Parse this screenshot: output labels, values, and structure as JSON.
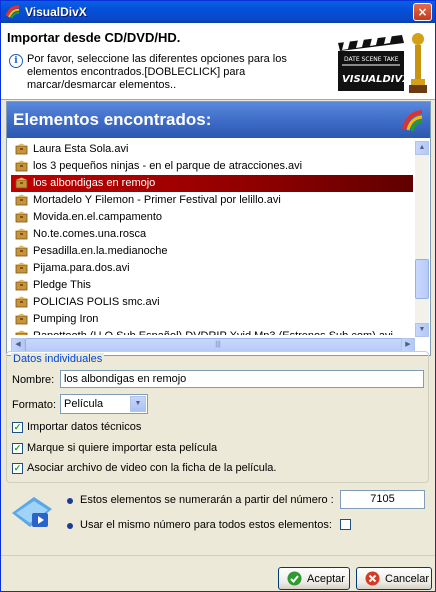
{
  "window": {
    "title": "VisualDivX",
    "close_label": "×"
  },
  "header": {
    "title": "Importar desde CD/DVD/HD.",
    "info_text": "Por favor, seleccione las diferentes opciones para los elementos encontrados.[DOBLECLICK] para marcar/desmarcar elementos..",
    "logo_text": "VISUALDIVX",
    "clapper_text": "DATE SCENE TAKE"
  },
  "found": {
    "title": "Elementos encontrados:",
    "items": [
      "Laura Esta Sola.avi",
      "los 3 pequeños ninjas - en el parque de atracciones.avi",
      "los albondigas en remojo",
      "Mortadelo Y Filemon - Primer Festival por lelillo.avi",
      "Movida.en.el.campamento",
      "No.te.comes.una.rosca",
      "Pesadilla.en.la.medianoche",
      "Pijama.para.dos.avi",
      "Pledge This",
      "POLICIAS POLIS smc.avi",
      "Pumping Iron",
      "Rapottooth (U.O Sub Español) DVDRIP Xvid Mp3 (Estrenos Sub.com).avi"
    ],
    "selected_index": 2
  },
  "individual": {
    "legend": "Datos individuales",
    "name_label": "Nombre:",
    "name_value": "los albondigas en remojo",
    "format_label": "Formato:",
    "format_value": "Película",
    "checkbox1": "Importar datos técnicos",
    "checkbox2": "Marque si quiere importar esta película",
    "checkbox3": "Asociar archivo de video con la ficha de la película."
  },
  "numbering": {
    "text1": "Estos elementos se numerarán a partir del número :",
    "number": "7105",
    "text2": "Usar el mismo número para todos estos elementos:"
  },
  "buttons": {
    "accept": "Aceptar",
    "cancel": "Cancelar"
  },
  "colors": {
    "accent": "#0a5fe6",
    "selection": "#c00000"
  }
}
